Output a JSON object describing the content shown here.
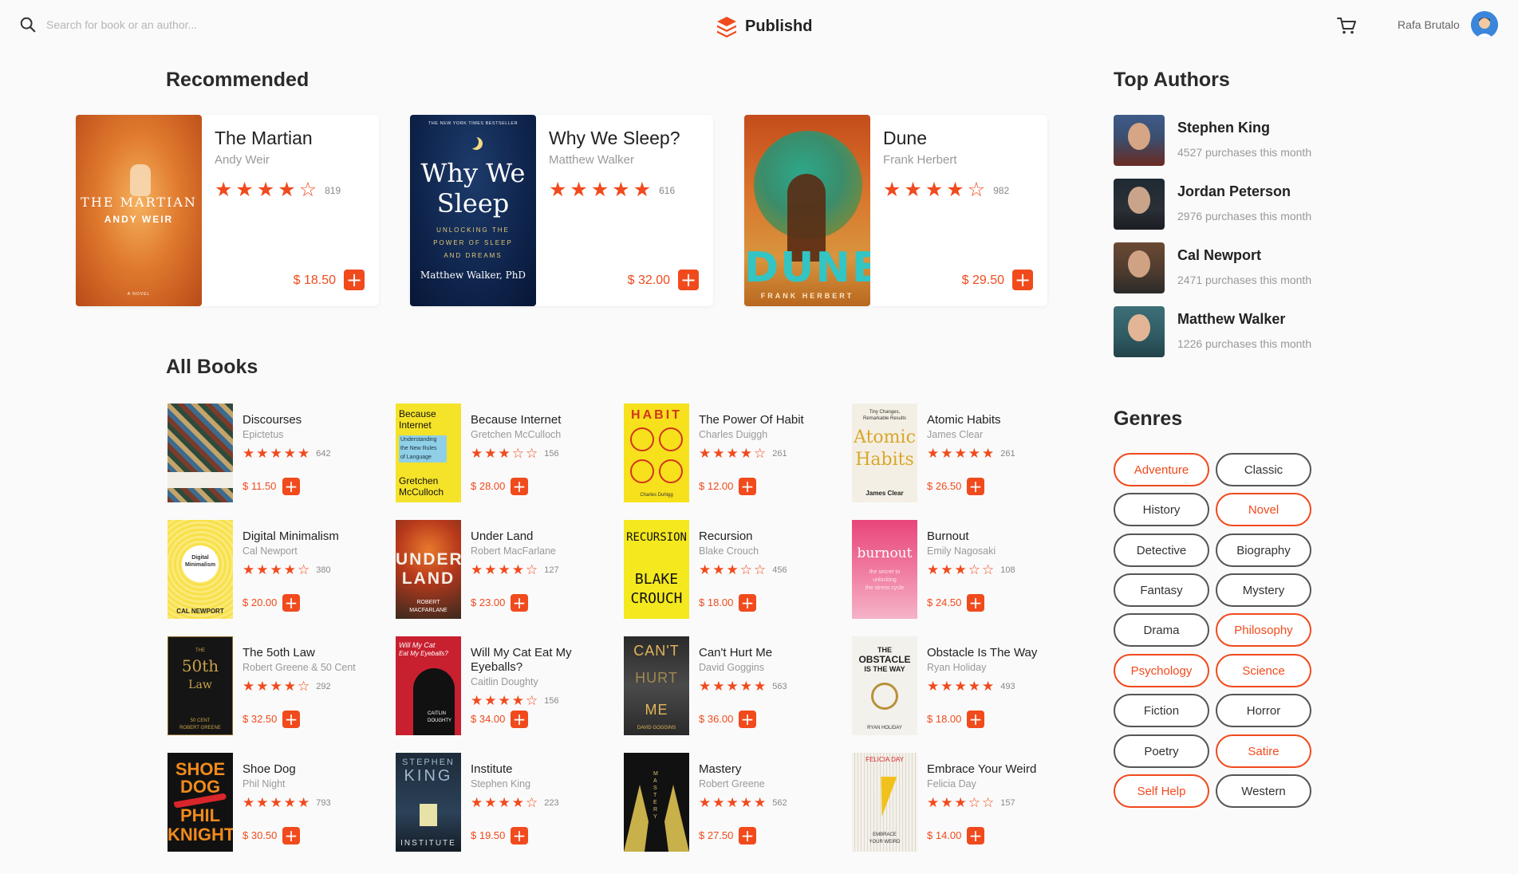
{
  "header": {
    "search_placeholder": "Search for book or an author...",
    "brand": "Publishd",
    "user_name": "Rafa Brutalo"
  },
  "colors": {
    "accent": "#f14a1d",
    "muted": "#999999",
    "text": "#222222",
    "background": "#fafafa"
  },
  "recommended": {
    "title": "Recommended",
    "books": [
      {
        "title": "The Martian",
        "author": "Andy Weir",
        "rating": 4,
        "count": "819",
        "price": "$ 18.50",
        "cover": {
          "lines": [
            "THE MARTIAN",
            "ANDY WEIR"
          ],
          "footer": "A NOVEL"
        }
      },
      {
        "title": "Why We Sleep?",
        "author": "Matthew Walker",
        "rating": 5,
        "count": "616",
        "price": "$ 32.00",
        "cover": {
          "top": "THE NEW YORK TIMES BESTSELLER",
          "lines": [
            "Why We",
            "Sleep"
          ],
          "sub": [
            "UNLOCKING THE",
            "POWER OF SLEEP",
            "AND DREAMS"
          ],
          "author": "Matthew Walker, PhD"
        }
      },
      {
        "title": "Dune",
        "author": "Frank Herbert",
        "rating": 4,
        "count": "982",
        "price": "$ 29.50",
        "cover": {
          "lines": [
            "DUNE"
          ],
          "author": "FRANK HERBERT"
        }
      }
    ]
  },
  "all_books": {
    "title": "All Books",
    "books": [
      {
        "title": "Discourses",
        "author": "Epictetus",
        "rating": 5,
        "count": "642",
        "price": "$ 11.50"
      },
      {
        "title": "Because Internet",
        "author": "Gretchen McCulloch",
        "rating": 3,
        "count": "156",
        "price": "$ 28.00",
        "cover": {
          "lines": [
            "Because",
            "Internet"
          ],
          "sub": [
            "Understanding",
            "the New Rules",
            "of Language"
          ],
          "author": [
            "Gretchen",
            "McCulloch"
          ]
        }
      },
      {
        "title": "The Power Of Habit",
        "author": "Charles Duiggh",
        "rating": 4,
        "count": "261",
        "price": "$ 12.00",
        "cover": {
          "lines": [
            "HABIT"
          ],
          "author": "Charles Duhigg"
        }
      },
      {
        "title": "Atomic Habits",
        "author": "James Clear",
        "rating": 5,
        "count": "261",
        "price": "$ 26.50",
        "cover": {
          "top": [
            "Tiny Changes,",
            "Remarkable Results"
          ],
          "lines": [
            "Atomic",
            "Habits"
          ],
          "author": "James Clear"
        }
      },
      {
        "title": "Digital Minimalism",
        "author": "Cal Newport",
        "rating": 4,
        "count": "380",
        "price": "$ 20.00",
        "cover": {
          "lines": [
            "Digital",
            "Minimalism"
          ],
          "author": "CAL NEWPORT"
        }
      },
      {
        "title": "Under Land",
        "author": "Robert MacFarlane",
        "rating": 4,
        "count": "127",
        "price": "$ 23.00",
        "cover": {
          "lines": [
            "UNDER",
            "LAND"
          ],
          "author": [
            "ROBERT",
            "MACFARLANE"
          ]
        }
      },
      {
        "title": "Recursion",
        "author": "Blake Crouch",
        "rating": 3,
        "count": "456",
        "price": "$ 18.00",
        "cover": {
          "lines": [
            "RECURSION",
            "BLAKE",
            "CROUCH"
          ]
        }
      },
      {
        "title": "Burnout",
        "author": "Emily Nagosaki",
        "rating": 3,
        "count": "108",
        "price": "$ 24.50",
        "cover": {
          "lines": [
            "burnout"
          ],
          "sub": [
            "the secret to",
            "unlocking",
            "the stress cycle"
          ]
        }
      },
      {
        "title": "The 5oth Law",
        "author": "Robert Greene & 50 Cent",
        "rating": 4,
        "count": "292",
        "price": "$ 32.50",
        "cover": {
          "lines": [
            "THE",
            "50th",
            "Law"
          ],
          "author": [
            "50 CENT",
            "ROBERT GREENE"
          ]
        }
      },
      {
        "title": "Will My Cat Eat My Eyeballs?",
        "author": "Caitlin Doughty",
        "rating": 4,
        "count": "156",
        "price": "$ 34.00",
        "cover": {
          "lines": [
            "Will My Cat",
            "Eat My Eyeballs?"
          ],
          "author": [
            "CAITLIN",
            "DOUGHTY"
          ]
        }
      },
      {
        "title": "Can't Hurt Me",
        "author": "David Goggins",
        "rating": 5,
        "count": "563",
        "price": "$ 36.00",
        "cover": {
          "lines": [
            "CAN'T",
            "HURT",
            "ME"
          ],
          "author": "DAVID GOGGINS"
        }
      },
      {
        "title": "Obstacle Is The Way",
        "author": "Ryan Holiday",
        "rating": 5,
        "count": "493",
        "price": "$ 18.00",
        "cover": {
          "lines": [
            "THE",
            "OBSTACLE",
            "IS THE WAY"
          ],
          "author": "RYAN HOLIDAY"
        }
      },
      {
        "title": "Shoe Dog",
        "author": "Phil Night",
        "rating": 5,
        "count": "793",
        "price": "$ 30.50",
        "cover": {
          "lines": [
            "SHOE",
            "DOG",
            "PHIL",
            "KNIGHT"
          ]
        }
      },
      {
        "title": "Institute",
        "author": "Stephen King",
        "rating": 4,
        "count": "223",
        "price": "$ 19.50",
        "cover": {
          "lines": [
            "STEPHEN",
            "KING"
          ],
          "author": "INSTITUTE"
        }
      },
      {
        "title": "Mastery",
        "author": "Robert Greene",
        "rating": 5,
        "count": "562",
        "price": "$ 27.50",
        "cover": {
          "lines": [
            "MASTERY"
          ]
        }
      },
      {
        "title": "Embrace Your Weird",
        "author": "Felicia Day",
        "rating": 3,
        "count": "157",
        "price": "$ 14.00",
        "cover": {
          "lines": [
            "FELICIA DAY"
          ],
          "author": [
            "EMBRACE",
            "YOUR WEIRD"
          ]
        }
      }
    ]
  },
  "top_authors": {
    "title": "Top Authors",
    "items": [
      {
        "name": "Stephen King",
        "sub": "4527 purchases this month"
      },
      {
        "name": "Jordan Peterson",
        "sub": "2976 purchases this month"
      },
      {
        "name": "Cal Newport",
        "sub": "2471 purchases this month"
      },
      {
        "name": "Matthew Walker",
        "sub": "1226 purchases this month"
      }
    ]
  },
  "genres": {
    "title": "Genres",
    "items": [
      {
        "label": "Adventure",
        "active": true
      },
      {
        "label": "Classic",
        "active": false
      },
      {
        "label": "History",
        "active": false
      },
      {
        "label": "Novel",
        "active": true
      },
      {
        "label": "Detective",
        "active": false
      },
      {
        "label": "Biography",
        "active": false
      },
      {
        "label": "Fantasy",
        "active": false
      },
      {
        "label": "Mystery",
        "active": false
      },
      {
        "label": "Drama",
        "active": false
      },
      {
        "label": "Philosophy",
        "active": true
      },
      {
        "label": "Psychology",
        "active": true
      },
      {
        "label": "Science",
        "active": true
      },
      {
        "label": "Fiction",
        "active": false
      },
      {
        "label": "Horror",
        "active": false
      },
      {
        "label": "Poetry",
        "active": false
      },
      {
        "label": "Satire",
        "active": true
      },
      {
        "label": "Self Help",
        "active": true
      },
      {
        "label": "Western",
        "active": false
      }
    ]
  }
}
